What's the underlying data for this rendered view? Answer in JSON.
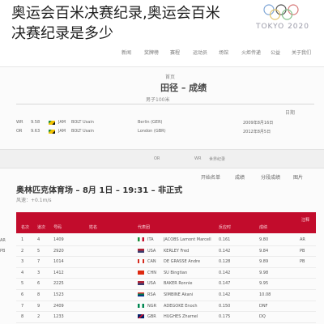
{
  "overlay": {
    "title_line1": "奥运会百米决赛纪录,奥运会百米",
    "title_line2": "决赛纪录是多少"
  },
  "brand": {
    "logo_text": "TOKYO 2020"
  },
  "nav": {
    "items": [
      "新闻",
      "奖牌榜",
      "赛程",
      "运动员",
      "场馆",
      "火炬传递",
      "公益",
      "关于我们"
    ]
  },
  "page": {
    "breadcrumb": "首页",
    "section_title": "田径 – 成绩",
    "event_subtitle": "男子100米",
    "date_label": "日期"
  },
  "records": {
    "rows": [
      {
        "type": "WR",
        "time": "9.58",
        "country": "JAM",
        "name": "BOLT Usain",
        "place": "Berlin (GER)",
        "date": "2009年8月16日"
      },
      {
        "type": "OR",
        "time": "9.63",
        "country": "JAM",
        "name": "BOLT Usain",
        "place": "London (GBR)",
        "date": "2012年8月5日"
      }
    ]
  },
  "bar": {
    "left_text": "OR",
    "mid_text": "WR",
    "right_text": "世界纪录"
  },
  "tabs": [
    "开始名单",
    "成绩",
    "分段成绩",
    "图片"
  ],
  "event": {
    "title": "奥林匹克体育场 – 8月 1日 – 19:31 – 非正式",
    "wind": "风速：+0.1m/s"
  },
  "results_header": {
    "col_rank": "名次",
    "col_lane": "道次",
    "col_bib": "号码",
    "col_name": "姓名",
    "col_country": "代表团",
    "col_rt": "反应时",
    "col_time": "成绩",
    "corner": "注释"
  },
  "results": [
    {
      "rank": "1",
      "lane": "4",
      "bib": "1409",
      "name": "JACOBS Lamont Marcell",
      "country": "ITA",
      "rt": "0.161",
      "time": "9.80",
      "note": "AR"
    },
    {
      "rank": "2",
      "lane": "5",
      "bib": "2920",
      "name": "KERLEY Fred",
      "country": "USA",
      "rt": "0.142",
      "time": "9.84",
      "note": "PB"
    },
    {
      "rank": "3",
      "lane": "7",
      "bib": "1014",
      "name": "DE GRASSE Andre",
      "country": "CAN",
      "rt": "0.128",
      "time": "9.89",
      "note": "PB"
    },
    {
      "rank": "4",
      "lane": "3",
      "bib": "1412",
      "name": "SU Bingtian",
      "country": "CHN",
      "rt": "0.142",
      "time": "9.98",
      "note": ""
    },
    {
      "rank": "5",
      "lane": "6",
      "bib": "2225",
      "name": "BAKER Ronnie",
      "country": "USA",
      "rt": "0.147",
      "time": "9.95",
      "note": ""
    },
    {
      "rank": "6",
      "lane": "8",
      "bib": "1523",
      "name": "SIMBINE Akani",
      "country": "RSA",
      "rt": "0.142",
      "time": "10.08",
      "note": ""
    },
    {
      "rank": "7",
      "lane": "9",
      "bib": "2409",
      "name": "ADEGOKE Enoch",
      "country": "NGR",
      "rt": "0.150",
      "time": "DNF",
      "note": ""
    },
    {
      "rank": "8",
      "lane": "2",
      "bib": "1233",
      "name": "HUGHES Zharnel",
      "country": "GBR",
      "rt": "0.175",
      "time": "DQ",
      "note": ""
    }
  ],
  "side_tags": [
    "AR",
    "PB"
  ],
  "colors": {
    "header_red": "#c20c2c",
    "jam_green": "#1a8f3a"
  }
}
